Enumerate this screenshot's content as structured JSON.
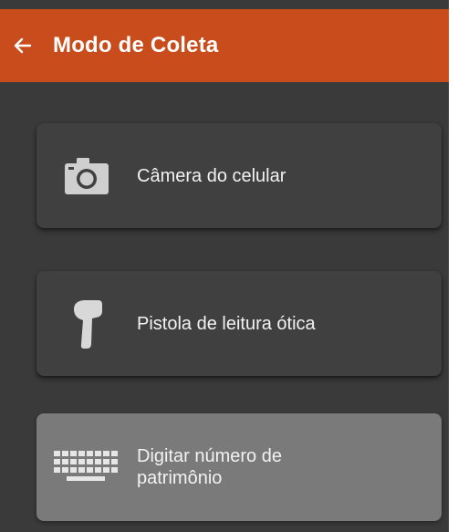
{
  "appbar": {
    "title": "Modo de Coleta",
    "back_icon": "arrow-left-icon",
    "color": "#c94c1c"
  },
  "options": [
    {
      "label": "Câmera do celular",
      "icon": "camera-icon",
      "selected": false
    },
    {
      "label": "Pistola de leitura ótica",
      "icon": "barcode-scanner-icon",
      "selected": false
    },
    {
      "label_line1": "Digitar número de",
      "label_line2": "patrimônio",
      "icon": "keyboard-icon",
      "selected": true
    }
  ],
  "colors": {
    "background": "#3a3a3a",
    "card": "#404040",
    "card_selected": "#7a7a7a",
    "text": "#f2f2f2"
  }
}
